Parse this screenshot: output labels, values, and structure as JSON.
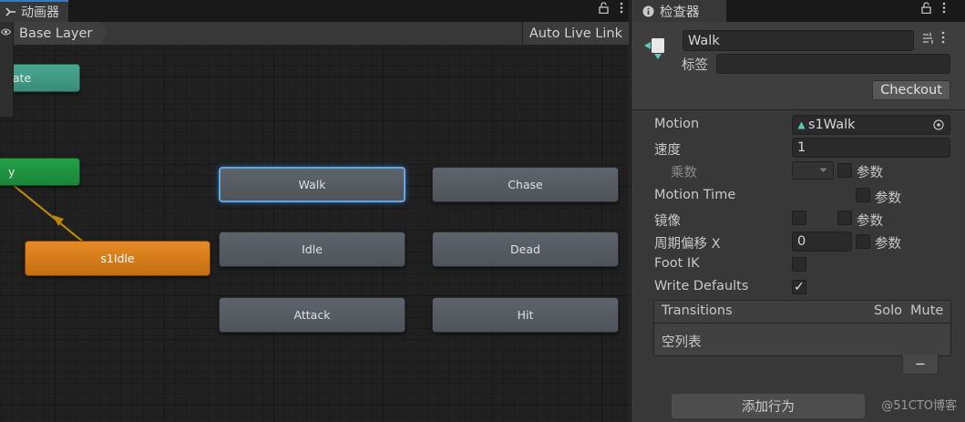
{
  "animator": {
    "tab_label": "动画器",
    "lock_icon": "lock-icon",
    "menu_icon": "kebab-menu-icon",
    "breadcrumb": "Base Layer",
    "auto_live_link": "Auto Live Link",
    "nodes": {
      "any_state": "tate",
      "entry": "y",
      "default_state": "s1Idle",
      "walk": "Walk",
      "chase": "Chase",
      "idle": "Idle",
      "dead": "Dead",
      "attack": "Attack",
      "hit": "Hit"
    },
    "colors": {
      "selected_outline": "#6aa6dd",
      "default_state": "#e68a25",
      "any_state": "#48a891",
      "entry": "#24a047",
      "transition_line": "#b8860b"
    }
  },
  "inspector": {
    "tab_label": "检查器",
    "name_value": "Walk",
    "tag_label": "标签",
    "tag_value": "",
    "checkout_label": "Checkout",
    "rows": {
      "motion_label": "Motion",
      "motion_value": "s1Walk",
      "speed_label": "速度",
      "speed_value": "1",
      "multiplier_label": "乘数",
      "param_label": "参数",
      "motion_time_label": "Motion Time",
      "mirror_label": "镜像",
      "cycle_offset_label": "周期偏移 X",
      "cycle_offset_value": "0",
      "foot_ik_label": "Foot IK",
      "write_defaults_label": "Write Defaults",
      "write_defaults_checked": "✓"
    },
    "transitions": {
      "header": "Transitions",
      "solo": "Solo",
      "mute": "Mute",
      "empty": "空列表",
      "remove_label": "−"
    },
    "add_behaviour": "添加行为",
    "watermark": "@51CTO博客"
  }
}
